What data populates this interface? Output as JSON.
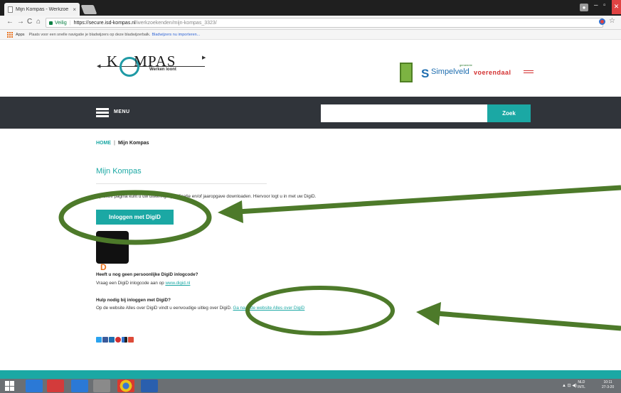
{
  "browser": {
    "tab_title": "Mijn Kompas - Werkzoe",
    "tab_close": "×",
    "window_user_icon": "user-icon",
    "url_secure": "Veilig",
    "url_host": "https://secure.isd-kompas.nl",
    "url_path": "/werkzoekenden/mijn-kompas_3323/",
    "bookmarks_apps": "Apps",
    "bookmarks_hint": "Plaats voor een snelle navigatie je bladwijzers op deze bladwijzerbalk.",
    "bookmarks_import": "Bladwijzers nu importeren..."
  },
  "header": {
    "logo_left": "K",
    "logo_right": "MPAS",
    "logo_tagline": "Werken loont",
    "partner_gemeente": "gemeente",
    "partner_simpelveld": "Simpelveld",
    "partner_voerendaal": "voerendaal"
  },
  "nav": {
    "menu_label": "MENU",
    "search_placeholder": "",
    "search_button": "Zoek"
  },
  "breadcrumb": {
    "home": "HOME",
    "separator": "|",
    "current": "Mijn Kompas"
  },
  "content": {
    "title": "Mijn Kompas",
    "intro": "Op deze pagina kunt u uw uitkeringsspecificatie en/of jaaropgave downloaden. Hiervoor logt u in met uw DigiD.",
    "login_button": "Inloggen met DigiD",
    "digid_logo_a": "Digi",
    "digid_logo_b": "D",
    "noid_heading": "Heeft u nog geen persoonlijke DigiD inlogcode?",
    "noid_text": "Vraag een DigiD inlogcode aan op ",
    "noid_link": "www.digid.nl",
    "help_heading": "Hulp nodig bij inloggen met DigiD?",
    "help_text": "Op de website Alles over DigiD vindt u eenvoudige uitleg over DigiD. ",
    "help_link": "Ga naar de website Alles over DigiD"
  },
  "social_icons": [
    "twitter-icon",
    "facebook-icon",
    "linkedin-icon",
    "pinterest-icon",
    "delicious-icon",
    "googleplus-icon"
  ],
  "taskbar": {
    "lang_top": "NLD",
    "lang_bottom": "INTL",
    "time": "10:11",
    "date": "27-3-20"
  },
  "colors": {
    "accent": "#1ba8a4",
    "nav_dark": "#30343a",
    "annotation_green": "#4d7a2a"
  }
}
